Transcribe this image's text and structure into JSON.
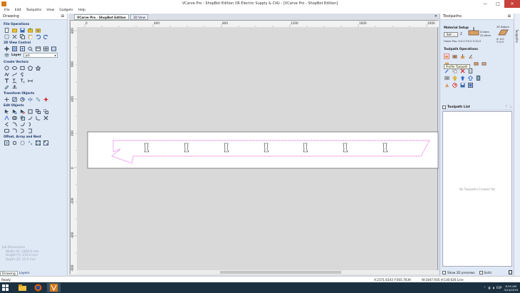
{
  "window": {
    "title": "VCarve Pro - ShopBot Edition (IR Electric Supply & CIA) - [VCarve Pro - ShopBot Edition]",
    "min": "—",
    "max": "□",
    "close": "✕"
  },
  "menu": [
    "File",
    "Edit",
    "Toolpaths",
    "View",
    "Gadgets",
    "Help"
  ],
  "left_panel": {
    "title": "Drawing",
    "pin": "⊞",
    "sections": {
      "file_ops": "File Operations",
      "view_2d": "2D View Control",
      "create_vectors": "Create Vectors",
      "transform": "Transform Objects",
      "edit": "Edit Objects",
      "offset": "Offset, Array and Nest"
    },
    "layer_label": "Layer",
    "layer_value": "pst",
    "job": {
      "title": "Job Dimensions",
      "width": "Width  (X): 2400.0 mm",
      "height": "Height (Y): 210.0 mm",
      "depth": "Depth  (Z): 22.0 mm"
    },
    "tabs": [
      "Drawing",
      "Layers"
    ]
  },
  "view": {
    "tabs": [
      "VCarve Pro - ShopBot Edition",
      "3D View"
    ],
    "close": "✕",
    "ruler": {
      "h": [
        "0",
        "400",
        "800",
        "1200",
        "1600",
        "2000"
      ],
      "v": [
        "800",
        "600",
        "400",
        "200",
        "0",
        "-200",
        "-400",
        "-600"
      ]
    }
  },
  "right_panel": {
    "title": "Toolpaths",
    "pin": "⊞",
    "material_setup": "Material Setup",
    "set_button": "Set ...",
    "thickness": "22.0mm",
    "z_offset": "0.0mm",
    "z_label": "Z",
    "xy_datum": "XY Datum",
    "x_val": "X: 0.0",
    "y_val": "Y: 0.0",
    "home_pos": "Home Pos:   X:0.0 Y:0.0 Z:20.0",
    "toolpath_ops": "Toolpath Operations",
    "tooltip": "Profile Toolpath",
    "toolpath_list": "Toolpath List",
    "no_toolpaths": "No Toolpaths Created Yet",
    "show_preview": "Show 2D previews",
    "solid": "Solid"
  },
  "side_tab": "Toolpaths",
  "status": {
    "ready": "Ready",
    "coords": "X:2371.6343 Y:565.7639",
    "size": "W:1847.935  H:130.626  Line"
  },
  "taskbar": {
    "lang": "ESP",
    "time": "8:35 AM",
    "date": "3/14/2016"
  },
  "colors": {
    "dashed_vector": "#e040e0",
    "panel_bg": "#dfe8f5",
    "canvas_bg": "#d9d9d9",
    "taskbar": "#1b3040"
  }
}
